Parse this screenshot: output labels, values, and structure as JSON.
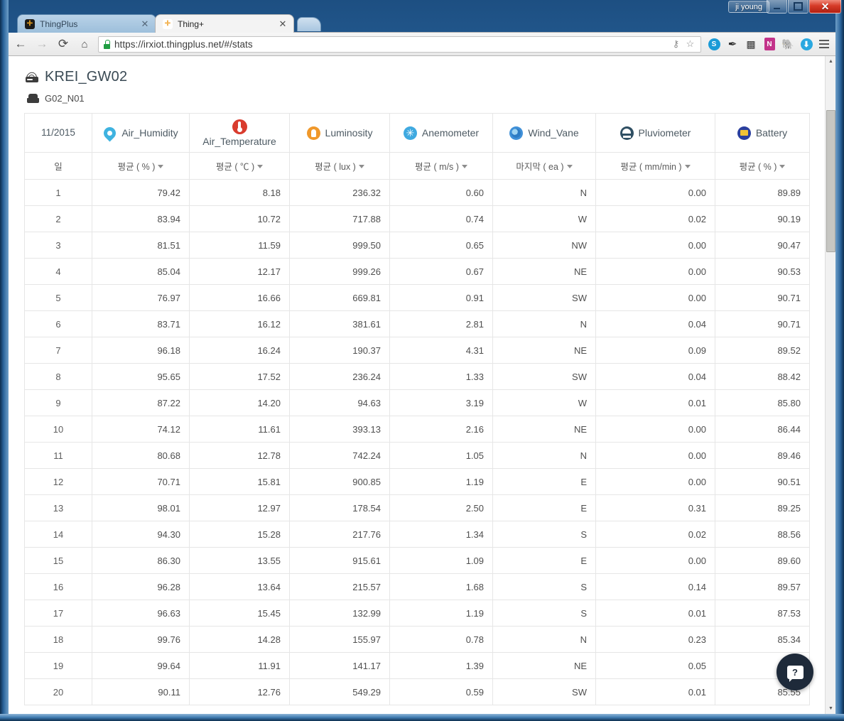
{
  "window": {
    "user_chip": "ji young",
    "minimize_label": "",
    "maximize_label": "",
    "close_label": "✕"
  },
  "tabs": [
    {
      "title": "ThingPlus",
      "favicon": "thingplus-dark-icon",
      "favicon_glyph": "✛",
      "close": "✕",
      "active": false
    },
    {
      "title": "Thing+",
      "favicon": "thingplus-orange-icon",
      "favicon_glyph": "✛",
      "close": "✕",
      "active": true
    }
  ],
  "navbar": {
    "back_icon": "←",
    "forward_icon": "→",
    "reload_icon": "⟳",
    "home_icon": "⌂",
    "url": "https://irxiot.thingplus.net/#/stats",
    "bookmark_icon": "☆",
    "key_icon": "⚷",
    "menu_icon": "hamburger-menu-icon",
    "extensions": [
      {
        "name": "shield-sync-icon",
        "glyph": "◉",
        "color": "#1a9bd7"
      },
      {
        "name": "pin-tool-icon",
        "glyph": "✒",
        "color": "#2f2f2f"
      },
      {
        "name": "translate-icon",
        "glyph": "❓",
        "color": "#3b3b3b"
      },
      {
        "name": "onenote-icon",
        "glyph": "N",
        "color": "#c3338a"
      },
      {
        "name": "evernote-icon",
        "glyph": "🐘",
        "color": "#6b3f2a"
      },
      {
        "name": "download-icon",
        "glyph": "⬇",
        "color": "#2aa8e0"
      }
    ]
  },
  "page": {
    "gateway_name": "KREI_GW02",
    "node_name": "G02_N01",
    "period_label": "11/2015",
    "day_label": "일",
    "help_button": "?",
    "columns": [
      {
        "name": "Air_Humidity",
        "icon": "humidity-icon",
        "agg": "평균 ( % )",
        "stacked": false
      },
      {
        "name": "Air_Temperature",
        "icon": "temperature-icon",
        "agg": "평균 ( ℃ )",
        "stacked": true
      },
      {
        "name": "Luminosity",
        "icon": "luminosity-icon",
        "agg": "평균 ( lux )",
        "stacked": false
      },
      {
        "name": "Anemometer",
        "icon": "anemometer-icon",
        "agg": "평균 ( m/s )",
        "stacked": false
      },
      {
        "name": "Wind_Vane",
        "icon": "wind-vane-icon",
        "agg": "마지막 ( ea )",
        "stacked": false
      },
      {
        "name": "Pluviometer",
        "icon": "pluviometer-icon",
        "agg": "평균 ( mm/min )",
        "stacked": false
      },
      {
        "name": "Battery",
        "icon": "battery-icon",
        "agg": "평균 ( % )",
        "stacked": false
      }
    ],
    "rows": [
      {
        "day": "1",
        "values": [
          "79.42",
          "8.18",
          "236.32",
          "0.60",
          "N",
          "0.00",
          "89.89"
        ]
      },
      {
        "day": "2",
        "values": [
          "83.94",
          "10.72",
          "717.88",
          "0.74",
          "W",
          "0.02",
          "90.19"
        ]
      },
      {
        "day": "3",
        "values": [
          "81.51",
          "11.59",
          "999.50",
          "0.65",
          "NW",
          "0.00",
          "90.47"
        ]
      },
      {
        "day": "4",
        "values": [
          "85.04",
          "12.17",
          "999.26",
          "0.67",
          "NE",
          "0.00",
          "90.53"
        ]
      },
      {
        "day": "5",
        "values": [
          "76.97",
          "16.66",
          "669.81",
          "0.91",
          "SW",
          "0.00",
          "90.71"
        ]
      },
      {
        "day": "6",
        "values": [
          "83.71",
          "16.12",
          "381.61",
          "2.81",
          "N",
          "0.04",
          "90.71"
        ]
      },
      {
        "day": "7",
        "values": [
          "96.18",
          "16.24",
          "190.37",
          "4.31",
          "NE",
          "0.09",
          "89.52"
        ]
      },
      {
        "day": "8",
        "values": [
          "95.65",
          "17.52",
          "236.24",
          "1.33",
          "SW",
          "0.04",
          "88.42"
        ]
      },
      {
        "day": "9",
        "values": [
          "87.22",
          "14.20",
          "94.63",
          "3.19",
          "W",
          "0.01",
          "85.80"
        ]
      },
      {
        "day": "10",
        "values": [
          "74.12",
          "11.61",
          "393.13",
          "2.16",
          "NE",
          "0.00",
          "86.44"
        ]
      },
      {
        "day": "11",
        "values": [
          "80.68",
          "12.78",
          "742.24",
          "1.05",
          "N",
          "0.00",
          "89.46"
        ]
      },
      {
        "day": "12",
        "values": [
          "70.71",
          "15.81",
          "900.85",
          "1.19",
          "E",
          "0.00",
          "90.51"
        ]
      },
      {
        "day": "13",
        "values": [
          "98.01",
          "12.97",
          "178.54",
          "2.50",
          "E",
          "0.31",
          "89.25"
        ]
      },
      {
        "day": "14",
        "values": [
          "94.30",
          "15.28",
          "217.76",
          "1.34",
          "S",
          "0.02",
          "88.56"
        ]
      },
      {
        "day": "15",
        "values": [
          "86.30",
          "13.55",
          "915.61",
          "1.09",
          "E",
          "0.00",
          "89.60"
        ]
      },
      {
        "day": "16",
        "values": [
          "96.28",
          "13.64",
          "215.57",
          "1.68",
          "S",
          "0.14",
          "89.57"
        ]
      },
      {
        "day": "17",
        "values": [
          "96.63",
          "15.45",
          "132.99",
          "1.19",
          "S",
          "0.01",
          "87.53"
        ]
      },
      {
        "day": "18",
        "values": [
          "99.76",
          "14.28",
          "155.97",
          "0.78",
          "N",
          "0.23",
          "85.34"
        ]
      },
      {
        "day": "19",
        "values": [
          "99.64",
          "11.91",
          "141.17",
          "1.39",
          "NE",
          "0.05",
          "8"
        ]
      },
      {
        "day": "20",
        "values": [
          "90.11",
          "12.76",
          "549.29",
          "0.59",
          "SW",
          "0.01",
          "85.55"
        ]
      }
    ]
  },
  "scrollbar": {
    "up_arrow": "▲",
    "down_arrow": "▼"
  }
}
